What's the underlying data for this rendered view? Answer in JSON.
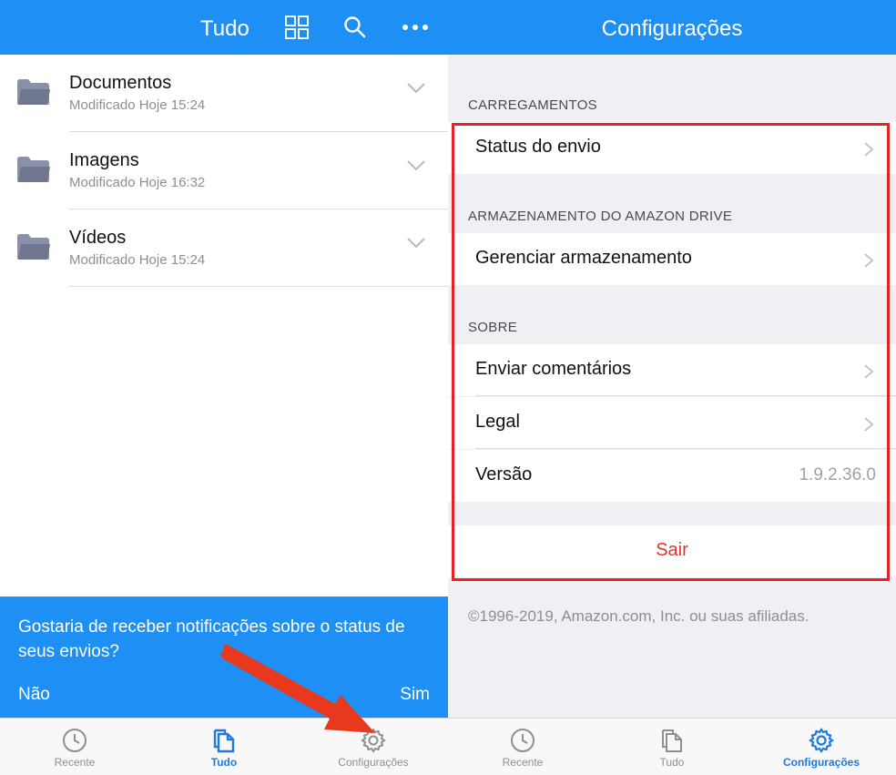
{
  "left": {
    "header": {
      "title": "Tudo",
      "icons": [
        "grid-icon",
        "search-icon",
        "more-icon"
      ]
    },
    "folders": [
      {
        "name": "Documentos",
        "modified": "Modificado Hoje 15:24"
      },
      {
        "name": "Imagens",
        "modified": "Modificado Hoje 16:32"
      },
      {
        "name": "Vídeos",
        "modified": "Modificado Hoje 15:24"
      }
    ],
    "banner": {
      "message": "Gostaria de receber notificações sobre o status de seus envios?",
      "no": "Não",
      "yes": "Sim"
    },
    "tabs": [
      {
        "label": "Recente",
        "icon": "clock-icon"
      },
      {
        "label": "Tudo",
        "icon": "files-icon",
        "active": true
      },
      {
        "label": "Configurações",
        "icon": "gear-icon"
      }
    ]
  },
  "right": {
    "header": {
      "title": "Configurações"
    },
    "sections": {
      "uploads": {
        "header": "CARREGAMENTOS",
        "status": "Status do envio"
      },
      "storage": {
        "header": "ARMAZENAMENTO DO AMAZON DRIVE",
        "manage": "Gerenciar armazenamento"
      },
      "about": {
        "header": "SOBRE",
        "feedback": "Enviar comentários",
        "legal": "Legal",
        "version_label": "Versão",
        "version_value": "1.9.2.36.0"
      }
    },
    "signout": "Sair",
    "copyright": "©1996-2019, Amazon.com, Inc. ou suas afiliadas.",
    "tabs": [
      {
        "label": "Recente",
        "icon": "clock-icon"
      },
      {
        "label": "Tudo",
        "icon": "files-icon"
      },
      {
        "label": "Configurações",
        "icon": "gear-icon",
        "active": true
      }
    ]
  },
  "colors": {
    "accent": "#1e90f5",
    "highlight": "#e42424",
    "signout": "#e0332b",
    "folder": "#8a90a8"
  }
}
